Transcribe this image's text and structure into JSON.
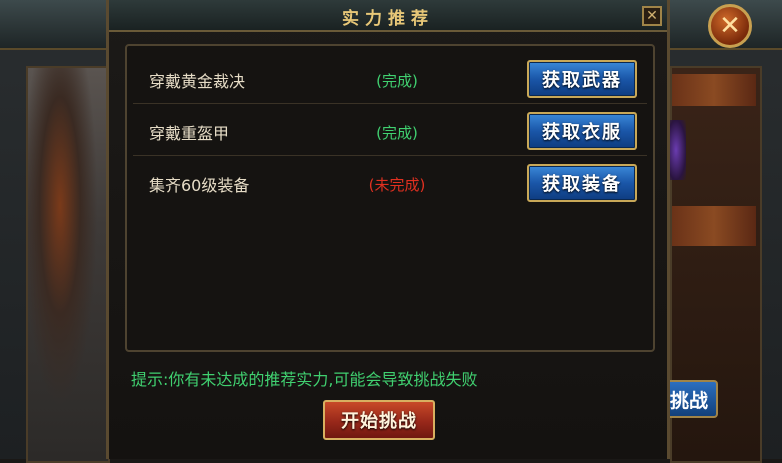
{
  "dialog": {
    "title": "实力推荐",
    "close_symbol": "✕"
  },
  "requirements": [
    {
      "label": "穿戴黄金裁决",
      "status": "(完成)",
      "done": true,
      "button": "获取武器"
    },
    {
      "label": "穿戴重盔甲",
      "status": "(完成)",
      "done": true,
      "button": "获取衣服"
    },
    {
      "label": "集齐60级装备",
      "status": "(未完成)",
      "done": false,
      "button": "获取装备"
    }
  ],
  "tip": "提示:你有未达成的推荐实力,可能会导致挑战失败",
  "start_button": "开始挑战",
  "background": {
    "challenge_partial": "挑战",
    "close_symbol": "✕"
  },
  "colors": {
    "done": "#40d070",
    "todo": "#e03020",
    "title": "#e8c878"
  }
}
